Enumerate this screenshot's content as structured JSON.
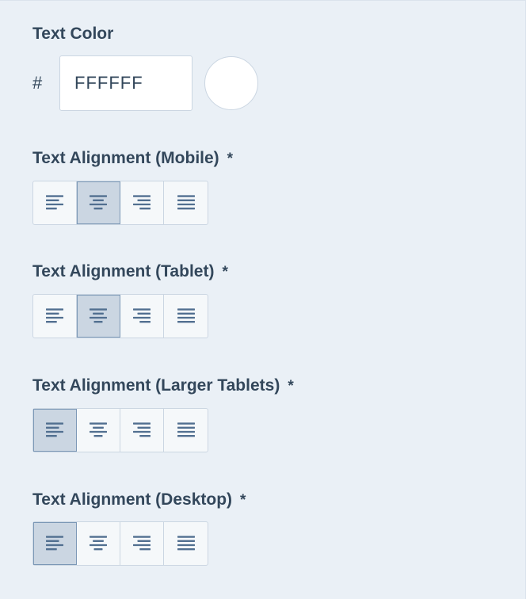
{
  "text_color": {
    "label": "Text Color",
    "hash": "#",
    "value": "FFFFFF",
    "swatch_color": "#ffffff"
  },
  "alignment_sections": [
    {
      "label": "Text Alignment (Mobile)",
      "required": "*",
      "selected": "center",
      "options": [
        "left",
        "center",
        "right",
        "justify"
      ]
    },
    {
      "label": "Text Alignment (Tablet)",
      "required": "*",
      "selected": "center",
      "options": [
        "left",
        "center",
        "right",
        "justify"
      ]
    },
    {
      "label": "Text Alignment (Larger Tablets)",
      "required": "*",
      "selected": "left",
      "options": [
        "left",
        "center",
        "right",
        "justify"
      ]
    },
    {
      "label": "Text Alignment (Desktop)",
      "required": "*",
      "selected": "left",
      "options": [
        "left",
        "center",
        "right",
        "justify"
      ]
    }
  ],
  "icons": {
    "left": "align-left-icon",
    "center": "align-center-icon",
    "right": "align-right-icon",
    "justify": "align-justify-icon"
  },
  "colors": {
    "background": "#eaf0f6",
    "text": "#33475b",
    "border": "#cbd6e2",
    "active_bg": "#cbd6e2",
    "icon": "#516f90"
  }
}
